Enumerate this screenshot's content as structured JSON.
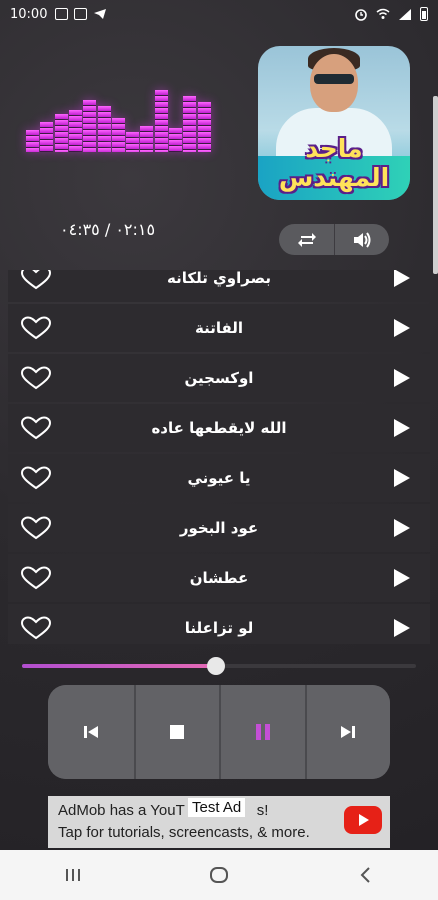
{
  "status_bar": {
    "time": "10:00",
    "left_icons": [
      "gallery-icon",
      "photos-icon",
      "telegram-icon"
    ],
    "right_icons": [
      "alarm-icon",
      "wifi-icon",
      "signal-icon",
      "battery-icon"
    ]
  },
  "album_art": {
    "title": "ماجد المهندس"
  },
  "player": {
    "time_readout": "٠٢:١٥ / ٠٤:٣٥",
    "progress_fraction": 0.492,
    "repeat_icon": "repeat-icon",
    "volume_icon": "volume-icon"
  },
  "playlist": {
    "tracks": [
      {
        "title": "بصراوي تلكانه"
      },
      {
        "title": "الفاتنة"
      },
      {
        "title": "اوكسجين"
      },
      {
        "title": "الله لايقطعها عاده"
      },
      {
        "title": "يا عيوني"
      },
      {
        "title": "عود البخور"
      },
      {
        "title": "عطشان"
      },
      {
        "title": "لو تزاعلنا"
      }
    ]
  },
  "transport": {
    "buttons": [
      "previous-icon",
      "stop-icon",
      "pause-icon",
      "next-icon"
    ],
    "accent_color": "#c44fd6"
  },
  "ad": {
    "badge": "Test Ad",
    "line1": "AdMob has a YouT",
    "line1_tail": "s!",
    "line2": "Tap for tutorials, screencasts, & more."
  },
  "nav": {
    "buttons": [
      "recents-icon",
      "home-icon",
      "back-icon"
    ]
  },
  "colors": {
    "equalizer": "#e04ef0",
    "background": "#2c2a2e"
  }
}
